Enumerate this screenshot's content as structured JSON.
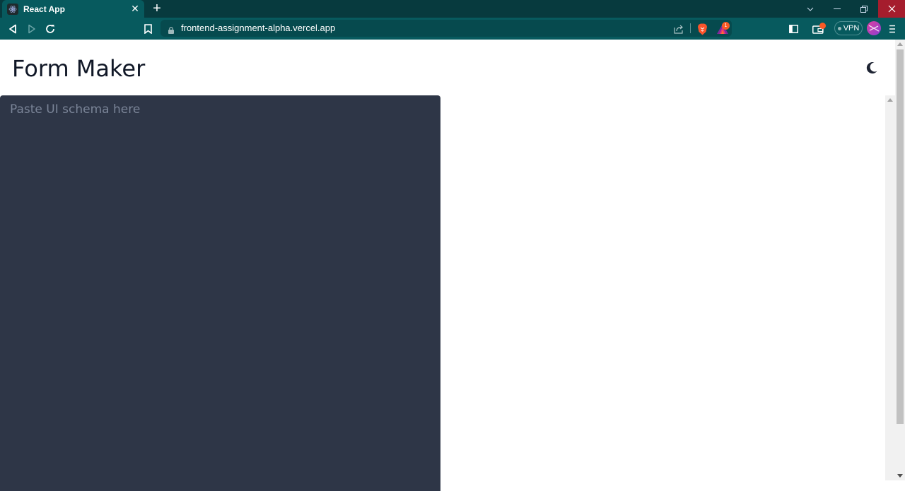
{
  "browser": {
    "tab": {
      "title": "React App",
      "favicon": "react-logo-icon"
    },
    "url": "frontend-assignment-alpha.vercel.app",
    "vpn_label": "VPN",
    "rewards_badge": "1",
    "colors": {
      "tabbar": "#073a3e",
      "toolbar": "#075a5e",
      "close_hover": "#a51d2d"
    }
  },
  "page": {
    "title": "Form Maker",
    "theme_toggle_icon": "moon-icon",
    "editor": {
      "placeholder": "Paste UI schema here",
      "value": ""
    },
    "colors": {
      "editor_bg": "#2e3647",
      "title": "#111827"
    }
  }
}
